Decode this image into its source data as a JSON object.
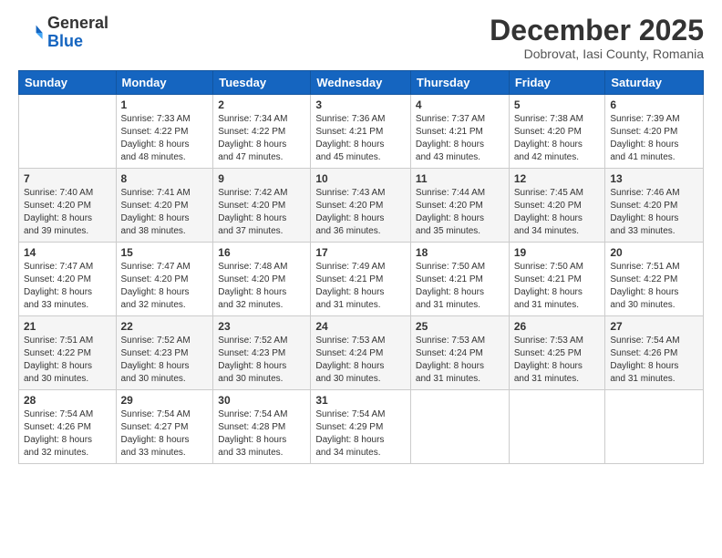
{
  "logo": {
    "general": "General",
    "blue": "Blue"
  },
  "header": {
    "month": "December 2025",
    "location": "Dobrovat, Iasi County, Romania"
  },
  "days_of_week": [
    "Sunday",
    "Monday",
    "Tuesday",
    "Wednesday",
    "Thursday",
    "Friday",
    "Saturday"
  ],
  "weeks": [
    [
      {
        "day": "",
        "info": ""
      },
      {
        "day": "1",
        "info": "Sunrise: 7:33 AM\nSunset: 4:22 PM\nDaylight: 8 hours\nand 48 minutes."
      },
      {
        "day": "2",
        "info": "Sunrise: 7:34 AM\nSunset: 4:22 PM\nDaylight: 8 hours\nand 47 minutes."
      },
      {
        "day": "3",
        "info": "Sunrise: 7:36 AM\nSunset: 4:21 PM\nDaylight: 8 hours\nand 45 minutes."
      },
      {
        "day": "4",
        "info": "Sunrise: 7:37 AM\nSunset: 4:21 PM\nDaylight: 8 hours\nand 43 minutes."
      },
      {
        "day": "5",
        "info": "Sunrise: 7:38 AM\nSunset: 4:20 PM\nDaylight: 8 hours\nand 42 minutes."
      },
      {
        "day": "6",
        "info": "Sunrise: 7:39 AM\nSunset: 4:20 PM\nDaylight: 8 hours\nand 41 minutes."
      }
    ],
    [
      {
        "day": "7",
        "info": "Sunrise: 7:40 AM\nSunset: 4:20 PM\nDaylight: 8 hours\nand 39 minutes."
      },
      {
        "day": "8",
        "info": "Sunrise: 7:41 AM\nSunset: 4:20 PM\nDaylight: 8 hours\nand 38 minutes."
      },
      {
        "day": "9",
        "info": "Sunrise: 7:42 AM\nSunset: 4:20 PM\nDaylight: 8 hours\nand 37 minutes."
      },
      {
        "day": "10",
        "info": "Sunrise: 7:43 AM\nSunset: 4:20 PM\nDaylight: 8 hours\nand 36 minutes."
      },
      {
        "day": "11",
        "info": "Sunrise: 7:44 AM\nSunset: 4:20 PM\nDaylight: 8 hours\nand 35 minutes."
      },
      {
        "day": "12",
        "info": "Sunrise: 7:45 AM\nSunset: 4:20 PM\nDaylight: 8 hours\nand 34 minutes."
      },
      {
        "day": "13",
        "info": "Sunrise: 7:46 AM\nSunset: 4:20 PM\nDaylight: 8 hours\nand 33 minutes."
      }
    ],
    [
      {
        "day": "14",
        "info": "Sunrise: 7:47 AM\nSunset: 4:20 PM\nDaylight: 8 hours\nand 33 minutes."
      },
      {
        "day": "15",
        "info": "Sunrise: 7:47 AM\nSunset: 4:20 PM\nDaylight: 8 hours\nand 32 minutes."
      },
      {
        "day": "16",
        "info": "Sunrise: 7:48 AM\nSunset: 4:20 PM\nDaylight: 8 hours\nand 32 minutes."
      },
      {
        "day": "17",
        "info": "Sunrise: 7:49 AM\nSunset: 4:21 PM\nDaylight: 8 hours\nand 31 minutes."
      },
      {
        "day": "18",
        "info": "Sunrise: 7:50 AM\nSunset: 4:21 PM\nDaylight: 8 hours\nand 31 minutes."
      },
      {
        "day": "19",
        "info": "Sunrise: 7:50 AM\nSunset: 4:21 PM\nDaylight: 8 hours\nand 31 minutes."
      },
      {
        "day": "20",
        "info": "Sunrise: 7:51 AM\nSunset: 4:22 PM\nDaylight: 8 hours\nand 30 minutes."
      }
    ],
    [
      {
        "day": "21",
        "info": "Sunrise: 7:51 AM\nSunset: 4:22 PM\nDaylight: 8 hours\nand 30 minutes."
      },
      {
        "day": "22",
        "info": "Sunrise: 7:52 AM\nSunset: 4:23 PM\nDaylight: 8 hours\nand 30 minutes."
      },
      {
        "day": "23",
        "info": "Sunrise: 7:52 AM\nSunset: 4:23 PM\nDaylight: 8 hours\nand 30 minutes."
      },
      {
        "day": "24",
        "info": "Sunrise: 7:53 AM\nSunset: 4:24 PM\nDaylight: 8 hours\nand 30 minutes."
      },
      {
        "day": "25",
        "info": "Sunrise: 7:53 AM\nSunset: 4:24 PM\nDaylight: 8 hours\nand 31 minutes."
      },
      {
        "day": "26",
        "info": "Sunrise: 7:53 AM\nSunset: 4:25 PM\nDaylight: 8 hours\nand 31 minutes."
      },
      {
        "day": "27",
        "info": "Sunrise: 7:54 AM\nSunset: 4:26 PM\nDaylight: 8 hours\nand 31 minutes."
      }
    ],
    [
      {
        "day": "28",
        "info": "Sunrise: 7:54 AM\nSunset: 4:26 PM\nDaylight: 8 hours\nand 32 minutes."
      },
      {
        "day": "29",
        "info": "Sunrise: 7:54 AM\nSunset: 4:27 PM\nDaylight: 8 hours\nand 33 minutes."
      },
      {
        "day": "30",
        "info": "Sunrise: 7:54 AM\nSunset: 4:28 PM\nDaylight: 8 hours\nand 33 minutes."
      },
      {
        "day": "31",
        "info": "Sunrise: 7:54 AM\nSunset: 4:29 PM\nDaylight: 8 hours\nand 34 minutes."
      },
      {
        "day": "",
        "info": ""
      },
      {
        "day": "",
        "info": ""
      },
      {
        "day": "",
        "info": ""
      }
    ]
  ]
}
